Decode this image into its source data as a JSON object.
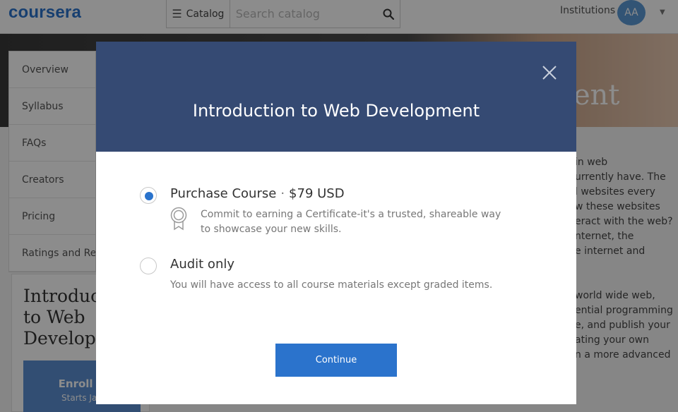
{
  "header": {
    "logo_text": "coursera",
    "catalog_label": "Catalog",
    "search_placeholder": "Search catalog",
    "institutions_label": "Institutions",
    "avatar_initials": "AA"
  },
  "hero": {
    "title_fragment": "ent"
  },
  "sidenav": {
    "items": [
      {
        "label": "Overview"
      },
      {
        "label": "Syllabus"
      },
      {
        "label": "FAQs"
      },
      {
        "label": "Creators"
      },
      {
        "label": "Pricing"
      },
      {
        "label": "Ratings and Revi"
      }
    ]
  },
  "course_card": {
    "title_lines": [
      "Introduc",
      "to Web",
      "Develop"
    ],
    "enroll_label": "Enroll N",
    "enroll_sub": "Starts Jan"
  },
  "description": {
    "lines": [
      "in web",
      "urrently have. The",
      "l websites every",
      "w these websites",
      "eract with the web?",
      "nternet, the",
      "e internet and"
    ],
    "lines2": [
      "world wide web,",
      "ential programming",
      "e, and publish your",
      "ating your own",
      "n a more advanced"
    ]
  },
  "modal": {
    "title": "Introduction to Web Development",
    "option_purchase": {
      "label": "Purchase Course",
      "separator": "·",
      "price": "$79 USD",
      "description": "Commit to earning a Certificate-it's a trusted, shareable way to showcase your new skills.",
      "selected": true
    },
    "option_audit": {
      "label": "Audit only",
      "description": "You will have access to all course materials except graded items.",
      "selected": false
    },
    "continue_label": "Continue"
  },
  "colors": {
    "brand_blue": "#2a73cc",
    "modal_header": "#354a73",
    "button_blue": "#2b73cc"
  }
}
